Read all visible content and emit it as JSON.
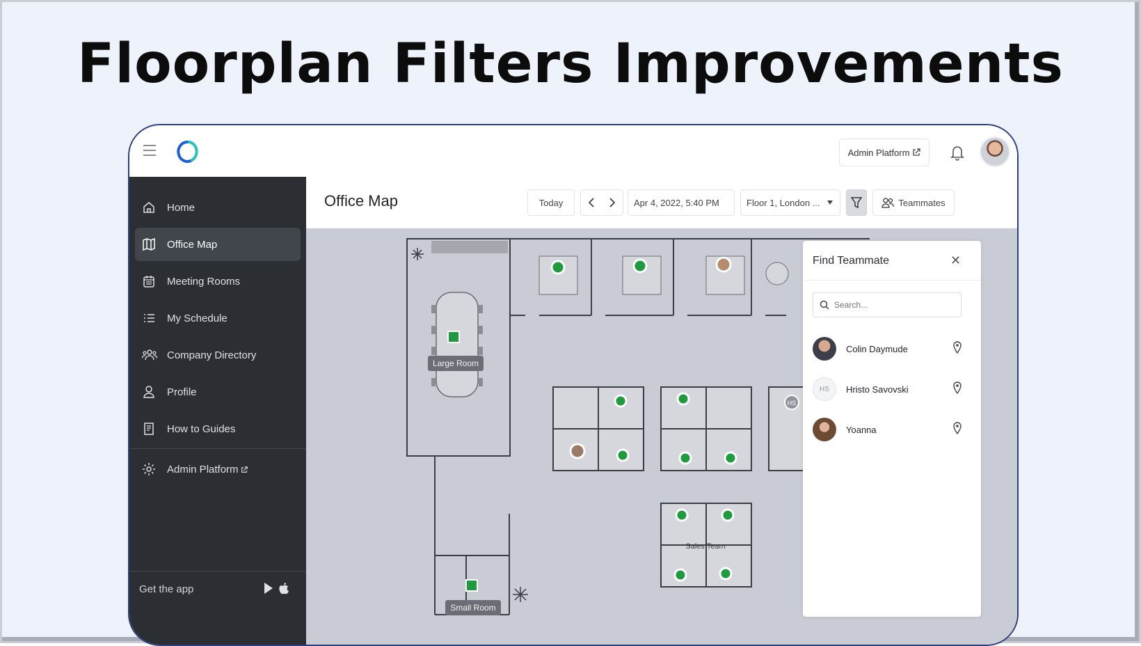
{
  "slide": {
    "title": "Floorplan Filters Improvements"
  },
  "topbar": {
    "admin_label": "Admin Platform"
  },
  "sidebar": {
    "items": [
      {
        "label": "Home",
        "icon": "home-icon"
      },
      {
        "label": "Office Map",
        "icon": "map-icon",
        "active": true
      },
      {
        "label": "Meeting Rooms",
        "icon": "calendar-icon"
      },
      {
        "label": "My Schedule",
        "icon": "list-icon"
      },
      {
        "label": "Company Directory",
        "icon": "people-icon"
      },
      {
        "label": "Profile",
        "icon": "user-icon"
      },
      {
        "label": "How to Guides",
        "icon": "book-icon"
      },
      {
        "label": "Admin Platform",
        "icon": "gear-icon"
      }
    ],
    "get_app": "Get the app"
  },
  "header": {
    "title": "Office Map",
    "today": "Today",
    "datetime": "Apr 4, 2022, 5:40 PM",
    "floor": "Floor 1, London ...",
    "teammates": "Teammates"
  },
  "map": {
    "large_room": "Large Room",
    "small_room": "Small Room",
    "sales_team": "Sales Team",
    "hs_initials": "HS"
  },
  "panel": {
    "title": "Find Teammate",
    "search_placeholder": "Search...",
    "teammates": [
      {
        "name": "Colin Daymude"
      },
      {
        "name": "Hristo Savovski",
        "initials": "HS"
      },
      {
        "name": "Yoanna"
      }
    ]
  },
  "colors": {
    "accent": "#2d3e7d",
    "sidebar": "#2b2f34",
    "desk_green": "#1f9a3e",
    "map_bg": "#c9ccd4"
  }
}
